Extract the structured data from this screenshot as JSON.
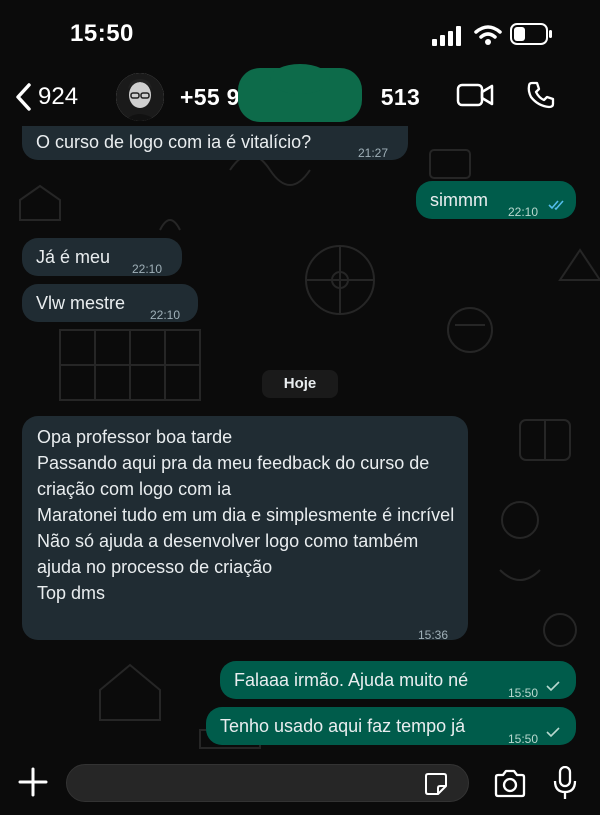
{
  "status_bar": {
    "time": "15:50"
  },
  "header": {
    "back_count": "924",
    "contact_name_start": "+55 95",
    "contact_name_end": "513",
    "icons": [
      "chevron-left-icon",
      "video-call-icon",
      "phone-call-icon"
    ]
  },
  "messages": [
    {
      "direction": "in",
      "text": "O curso de logo com ia é vitalício?",
      "time": "21:27"
    },
    {
      "direction": "out",
      "text": "simmm",
      "time": "22:10",
      "status": "read"
    },
    {
      "direction": "in",
      "text": "Já é meu",
      "time": "22:10"
    },
    {
      "direction": "in",
      "text": "Vlw mestre",
      "time": "22:10"
    },
    {
      "direction": "in",
      "text": "Opa professor boa tarde\nPassando aqui pra da meu feedback do curso de criação com logo com ia\nMaratonei tudo em um dia e simplesmente é incrível\nNão só ajuda a desenvolver logo como também ajuda no processo de criação\nTop dms",
      "time": "15:36"
    },
    {
      "direction": "out",
      "text": "Falaaa irmão. Ajuda muito né",
      "time": "15:50",
      "status": "sent"
    },
    {
      "direction": "out",
      "text": "Tenho usado aqui faz tempo já",
      "time": "15:50",
      "status": "sent"
    }
  ],
  "day_divider": "Hoje",
  "composer": {
    "placeholder": "",
    "icons": [
      "plus-icon",
      "sticker-icon",
      "camera-icon",
      "microphone-icon"
    ]
  },
  "colors": {
    "incoming_bubble": "#202c33",
    "outgoing_bubble": "#005c4b",
    "read_ticks": "#53bdeb",
    "background": "#0b0b0b"
  }
}
